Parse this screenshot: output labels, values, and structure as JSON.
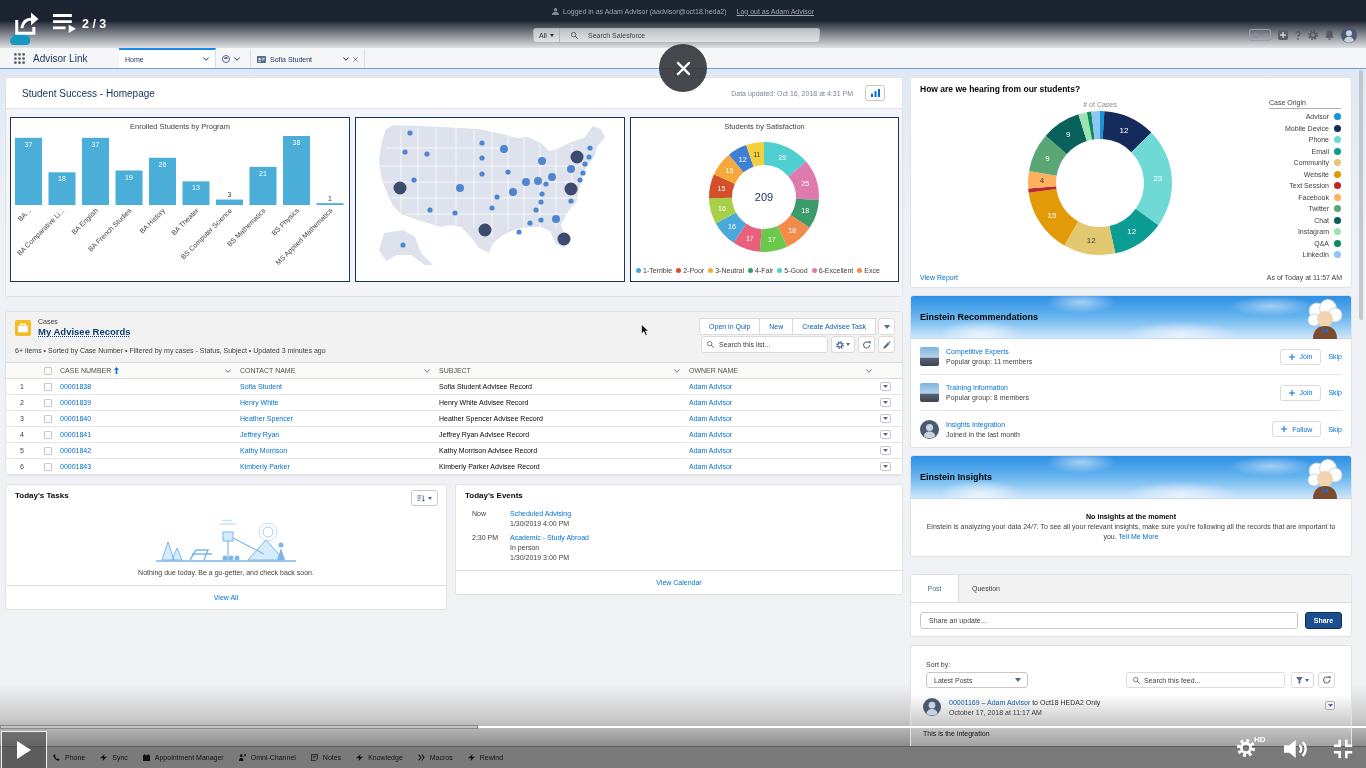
{
  "video": {
    "playlist_position": "2 / 3",
    "quality": "HD",
    "progress": {
      "level": 0.35
    }
  },
  "login_bar": {
    "text": "Logged in as Adam Advisor (aadvisor@oct18.heda2)",
    "logout_link": "Log out as Adam Advisor"
  },
  "header": {
    "search_scope": "All",
    "search_placeholder": "Search Salesforce"
  },
  "navigation": {
    "app_name": "Advisor Link",
    "tabs": [
      {
        "kind": "page",
        "label": "Home",
        "selected": true,
        "closable": false
      },
      {
        "kind": "menu",
        "selected": false,
        "closable": false
      },
      {
        "kind": "record",
        "label": "Sofia Student",
        "selected": false,
        "closable": true
      }
    ]
  },
  "dashboard": {
    "title": "Student Success - Homepage",
    "updated": "Data updated: Oct 16, 2018 at 4:31 PM",
    "program_chart": {
      "chart_data": {
        "type": "bar",
        "title": "Enrolled Students by Program",
        "categories": [
          "BA...",
          "BA Comparative Li...",
          "BA English",
          "BA French Studies",
          "BA History",
          "BA Theater",
          "BS Computer Science",
          "BS Mathematics",
          "BS Physics",
          "MS Applied Mathematics"
        ],
        "values": [
          37,
          18,
          37,
          19,
          26,
          13,
          3,
          21,
          38,
          1
        ],
        "value_labels": [
          "37",
          "18",
          "37",
          "19",
          "26",
          "13",
          "3",
          "21",
          "38",
          "1"
        ]
      }
    },
    "satisfaction_chart": {
      "chart_data": {
        "type": "donut",
        "title": "Students by Satisfaction",
        "values": [
          29,
          25,
          18,
          18,
          17,
          17,
          16,
          16,
          15,
          15,
          12,
          11
        ],
        "data_labels": true
      },
      "total": "209",
      "slices": [
        {
          "color": "#4fcfcf"
        },
        {
          "color": "#de7aad"
        },
        {
          "color": "#3c9b6a"
        },
        {
          "color": "#f08b4a"
        },
        {
          "color": "#6cc84a"
        },
        {
          "color": "#e8607c"
        },
        {
          "color": "#4aa8db"
        },
        {
          "color": "#a6d04a"
        },
        {
          "color": "#d4502a"
        },
        {
          "color": "#f5a93a"
        },
        {
          "color": "#3f7fd6"
        },
        {
          "color": "#f4d03f"
        }
      ],
      "legend": [
        {
          "label": "1-Terrible",
          "color": "#4aa8db"
        },
        {
          "label": "2-Poor",
          "color": "#d4502a"
        },
        {
          "label": "3-Neutral",
          "color": "#f5a93a"
        },
        {
          "label": "4-Fair",
          "color": "#3c9b6a"
        },
        {
          "label": "5-Good",
          "color": "#4fcfcf"
        },
        {
          "label": "6-Excellent",
          "color": "#de7aad"
        },
        {
          "label": "Exce",
          "color": "#f08b4a"
        }
      ]
    }
  },
  "cases": {
    "object": "Cases",
    "title": "My Advisee Records",
    "info": "6+ items • Sorted by Case Number • Filtered by my cases - Status, Subject • Updated 3 minutes ago",
    "actions": [
      "Open in Quip",
      "New",
      "Create Advisee Task"
    ],
    "search_placeholder": "Search this list...",
    "all_selected": false,
    "columns": [
      {
        "label": "CASE NUMBER",
        "sorted": true
      },
      {
        "label": "CONTACT NAME",
        "sorted": false
      },
      {
        "label": "SUBJECT",
        "sorted": false
      },
      {
        "label": "OWNER NAME",
        "sorted": false
      }
    ],
    "rows": [
      {
        "number": "1",
        "case_number": "00001838",
        "contact": "Sofia Student",
        "subject": "Sofia Student Advisee Record",
        "owner": "Adam Advisor",
        "selected": false
      },
      {
        "number": "2",
        "case_number": "00001839",
        "contact": "Henry White",
        "subject": "Henry White Advisee Record",
        "owner": "Adam Advisor",
        "selected": false
      },
      {
        "number": "3",
        "case_number": "00001840",
        "contact": "Heather Spencer",
        "subject": "Heather Spencer Advisee Record",
        "owner": "Adam Advisor",
        "selected": false
      },
      {
        "number": "4",
        "case_number": "00001841",
        "contact": "Jeffrey Ryan",
        "subject": "Jeffrey Ryan Advisee Record",
        "owner": "Adam Advisor",
        "selected": false
      },
      {
        "number": "5",
        "case_number": "00001842",
        "contact": "Kathy Morrison",
        "subject": "Kathy Morrison Advisee Record",
        "owner": "Adam Advisor",
        "selected": false
      },
      {
        "number": "6",
        "case_number": "00001843",
        "contact": "Kimberly Parker",
        "subject": "Kimberly Parker Advisee Record",
        "owner": "Adam Advisor",
        "selected": false
      }
    ]
  },
  "tasks": {
    "title": "Today's Tasks",
    "empty_message": "Nothing due today. Be a go-getter, and check back soon.",
    "footer_link": "View All"
  },
  "events": {
    "title": "Today's Events",
    "items": [
      {
        "time": "Now",
        "title": "Scheduled Advising",
        "details": [
          "1/30/2019 4:00 PM"
        ]
      },
      {
        "time": "2:30 PM",
        "title": "Academic - Study Abroad",
        "details": [
          "In person",
          "1/30/2019 3:00 PM"
        ]
      }
    ],
    "footer_link": "View Calendar"
  },
  "case_origin": {
    "title": "How are we hearing from our students?",
    "chart_data": {
      "type": "donut",
      "title": "# of Cases",
      "categories": [
        "Advisor",
        "Mobile Device",
        "Phone",
        "Email",
        "Community",
        "Website",
        "Text Session",
        "Facebook",
        "Twitter",
        "Chat",
        "Instagram",
        "Q&A",
        "LinkedIn"
      ],
      "values": [
        1,
        12,
        23,
        12,
        12,
        15,
        1,
        4,
        9,
        9,
        2,
        1,
        2
      ],
      "value_labels": [
        null,
        "12",
        "23",
        "12",
        "12",
        "15",
        null,
        "4",
        "9",
        "9",
        null,
        null,
        null
      ],
      "legend": {
        "title": "Case Origin"
      }
    },
    "slices": [
      {
        "color": "#0f97d8"
      },
      {
        "color": "#142b5c"
      },
      {
        "color": "#6fdad5"
      },
      {
        "color": "#0b9d94"
      },
      {
        "color": "#e3c872"
      },
      {
        "color": "#e39a08"
      },
      {
        "color": "#b9292d"
      },
      {
        "color": "#ffb15f"
      },
      {
        "color": "#58a774"
      },
      {
        "color": "#08625b"
      },
      {
        "color": "#9be3b0"
      },
      {
        "color": "#0d8a5e"
      },
      {
        "color": "#8fc5f5"
      }
    ],
    "footer_link": "View Report",
    "timestamp": "As of Today at 11:57 AM"
  },
  "recommendations": {
    "title": "Einstein Recommendations",
    "items": [
      {
        "kind": "group",
        "title": "Competitive Experts",
        "subtitle": "Popular group: 11 members",
        "action": "Join",
        "skip": "Skip"
      },
      {
        "kind": "group",
        "title": "Training Information",
        "subtitle": "Popular group: 8 members",
        "action": "Join",
        "skip": "Skip"
      },
      {
        "kind": "user",
        "title": "Insights Integration",
        "subtitle": "Joined in the last month",
        "action": "Follow",
        "skip": "Skip"
      }
    ]
  },
  "insights": {
    "title": "Einstein Insights",
    "heading": "No insights at the moment",
    "message": "Einstein is analyzing your data 24/7. To see all your relevant insights, make sure you're following all the records that are important to you.",
    "link": "Tell Me More"
  },
  "publisher": {
    "tabs": [
      {
        "label": "Post",
        "selected": true
      },
      {
        "label": "Question",
        "selected": false
      }
    ],
    "placeholder": "Share an update...",
    "button": "Share"
  },
  "feed": {
    "sort_label": "Sort by:",
    "sort_value": "Latest Posts",
    "search_placeholder": "Search this feed...",
    "posts": [
      {
        "record": "00001169",
        "separator": "–",
        "author": "Adam Advisor",
        "audience": "to Oct18 HEDA2 Only",
        "timestamp": "October 17, 2018 at 11:17 AM",
        "body": "This is the integration"
      }
    ]
  },
  "utility_bar": {
    "items": [
      {
        "kind": "phone",
        "label": "Phone"
      },
      {
        "kind": "bolt",
        "label": "Sync"
      },
      {
        "kind": "calendar",
        "label": "Appointment Manager"
      },
      {
        "kind": "routing",
        "label": "Omni-Channel"
      },
      {
        "kind": "note",
        "label": "Notes"
      },
      {
        "kind": "bolt",
        "label": "Knowledge"
      },
      {
        "kind": "macro",
        "label": "Macros"
      },
      {
        "kind": "bolt",
        "label": "Rewind"
      }
    ]
  }
}
